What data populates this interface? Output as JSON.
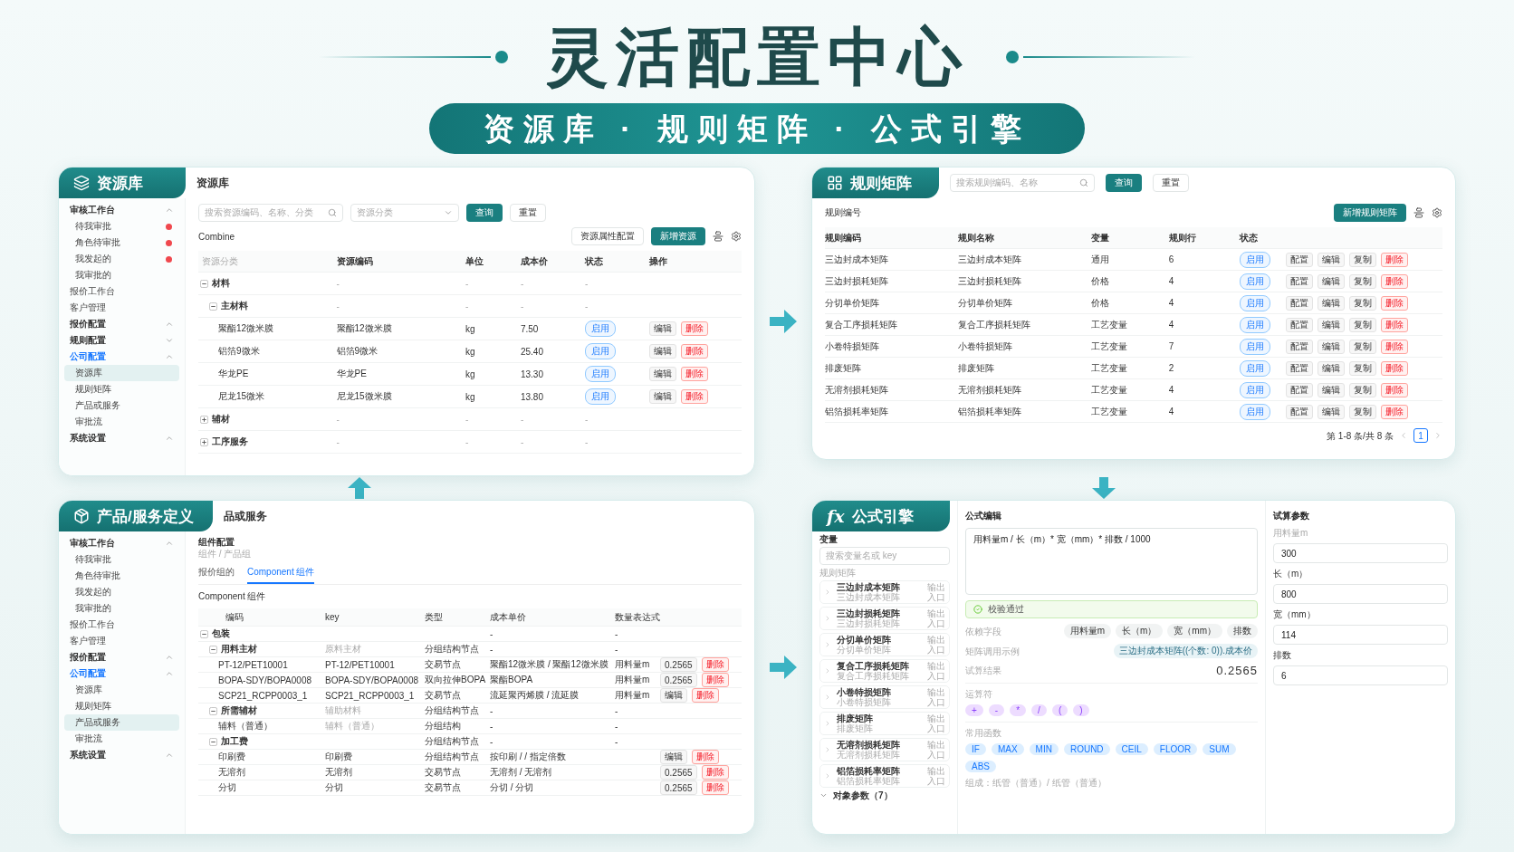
{
  "header": {
    "title": "灵活配置中心",
    "subtitle": "资源库 · 规则矩阵 · 公式引擎"
  },
  "resource_panel": {
    "tab": "资源库",
    "title": "资源库",
    "sidebar": [
      {
        "kind": "group",
        "label": "审核工作台",
        "expanded": true,
        "active": false,
        "children": [
          {
            "label": "待我审批",
            "selected": false,
            "alert": true
          },
          {
            "label": "角色待审批",
            "selected": false,
            "alert": true
          },
          {
            "label": "我发起的",
            "selected": false,
            "alert": true
          },
          {
            "label": "我审批的",
            "selected": false,
            "alert": false
          }
        ]
      },
      {
        "kind": "link",
        "label": "报价工作台"
      },
      {
        "kind": "link",
        "label": "客户管理"
      },
      {
        "kind": "group",
        "label": "报价配置",
        "expanded": true,
        "active": false
      },
      {
        "kind": "group",
        "label": "规则配置",
        "expanded": false,
        "active": false
      },
      {
        "kind": "group",
        "label": "公司配置",
        "expanded": true,
        "active": true,
        "children": [
          {
            "label": "资源库",
            "selected": true,
            "alert": false
          },
          {
            "label": "规则矩阵",
            "selected": false,
            "alert": false
          },
          {
            "label": "产品或服务",
            "selected": false,
            "alert": false
          },
          {
            "label": "审批流",
            "selected": false,
            "alert": false
          }
        ]
      },
      {
        "kind": "group",
        "label": "系统设置",
        "expanded": true,
        "active": false
      }
    ],
    "search": {
      "placeholder": "搜索资源编码、名称、分类"
    },
    "category_select": {
      "placeholder": "资源分类"
    },
    "query_button": "查询",
    "reset_button": "重置",
    "section_label": "Combine",
    "attr_button": "资源属性配置",
    "add_button": "新增资源",
    "columns": [
      "资源分类",
      "资源编码",
      "单位",
      "成本价",
      "状态",
      "操作"
    ],
    "rows": [
      {
        "expanded": true,
        "cells": [
          "材料",
          "-",
          "-",
          "-",
          "-"
        ],
        "children": [
          {
            "expanded": true,
            "cells": [
              "主材料",
              "-",
              "-",
              "-",
              "-"
            ],
            "children": [
              {
                "cells": [
                  "聚酯12微米膜",
                  "聚酯12微米膜",
                  "kg",
                  "7.50"
                ],
                "status": "启用",
                "actions": [
                  {
                    "label": "编辑",
                    "kind": "default"
                  },
                  {
                    "label": "删除",
                    "kind": "danger"
                  }
                ]
              },
              {
                "cells": [
                  "铝箔9微米",
                  "铝箔9微米",
                  "kg",
                  "25.40"
                ],
                "status": "启用",
                "actions": [
                  {
                    "label": "编辑",
                    "kind": "default"
                  },
                  {
                    "label": "删除",
                    "kind": "danger"
                  }
                ]
              },
              {
                "cells": [
                  "华龙PE",
                  "华龙PE",
                  "kg",
                  "13.30"
                ],
                "status": "启用",
                "actions": [
                  {
                    "label": "编辑",
                    "kind": "default"
                  },
                  {
                    "label": "删除",
                    "kind": "danger"
                  }
                ]
              },
              {
                "cells": [
                  "尼龙15微米",
                  "尼龙15微米膜",
                  "kg",
                  "13.80"
                ],
                "status": "启用",
                "actions": [
                  {
                    "label": "编辑",
                    "kind": "default"
                  },
                  {
                    "label": "删除",
                    "kind": "danger"
                  }
                ]
              }
            ]
          }
        ]
      },
      {
        "expanded": false,
        "cells": [
          "辅材",
          "-",
          "-",
          "-",
          "-"
        ]
      },
      {
        "expanded": false,
        "cells": [
          "工序服务",
          "-",
          "-",
          "-",
          "-"
        ]
      }
    ]
  },
  "rules_panel": {
    "tab": "规则矩阵",
    "search": {
      "placeholder": "搜索规则编码、名称"
    },
    "query_button": "查询",
    "reset_button": "重置",
    "section_label": "规则编号",
    "add_button": "新增规则矩阵",
    "columns": [
      "规则编码",
      "规则名称",
      "变量",
      "规则行",
      "状态"
    ],
    "rows": [
      {
        "cells": [
          "三边封成本矩阵",
          "三边封成本矩阵",
          "通用",
          "6"
        ],
        "status": "启用",
        "actions": [
          "配置",
          "编辑",
          "复制",
          "删除"
        ]
      },
      {
        "cells": [
          "三边封损耗矩阵",
          "三边封损耗矩阵",
          "价格",
          "4"
        ],
        "status": "启用",
        "actions": [
          "配置",
          "编辑",
          "复制",
          "删除"
        ]
      },
      {
        "cells": [
          "分切单价矩阵",
          "分切单价矩阵",
          "价格",
          "4"
        ],
        "status": "启用",
        "actions": [
          "配置",
          "编辑",
          "复制",
          "删除"
        ]
      },
      {
        "cells": [
          "复合工序损耗矩阵",
          "复合工序损耗矩阵",
          "工艺变量",
          "4"
        ],
        "status": "启用",
        "actions": [
          "配置",
          "编辑",
          "复制",
          "删除"
        ]
      },
      {
        "cells": [
          "小卷特损矩阵",
          "小卷特损矩阵",
          "工艺变量",
          "7"
        ],
        "status": "启用",
        "actions": [
          "配置",
          "编辑",
          "复制",
          "删除"
        ]
      },
      {
        "cells": [
          "排废矩阵",
          "排废矩阵",
          "工艺变量",
          "2"
        ],
        "status": "启用",
        "actions": [
          "配置",
          "编辑",
          "复制",
          "删除"
        ]
      },
      {
        "cells": [
          "无溶剂损耗矩阵",
          "无溶剂损耗矩阵",
          "工艺变量",
          "4"
        ],
        "status": "启用",
        "actions": [
          "配置",
          "编辑",
          "复制",
          "删除"
        ]
      },
      {
        "cells": [
          "铝箔损耗率矩阵",
          "铝箔损耗率矩阵",
          "工艺变量",
          "4"
        ],
        "status": "启用",
        "actions": [
          "配置",
          "编辑",
          "复制",
          "删除"
        ]
      }
    ],
    "pagination": {
      "summary": "第 1-8 条/共 8 条",
      "pages": [
        {
          "label": "1",
          "selected": true
        }
      ]
    }
  },
  "product_panel": {
    "tab": "产品/服务定义",
    "title": "品或服务",
    "sidebar": [
      {
        "kind": "group",
        "label": "审核工作台",
        "expanded": true,
        "active": false,
        "children": [
          {
            "label": "待我审批",
            "selected": false,
            "alert": false
          },
          {
            "label": "角色待审批",
            "selected": false,
            "alert": false
          },
          {
            "label": "我发起的",
            "selected": false,
            "alert": false
          },
          {
            "label": "我审批的",
            "selected": false,
            "alert": false
          }
        ]
      },
      {
        "kind": "link",
        "label": "报价工作台"
      },
      {
        "kind": "link",
        "label": "客户管理"
      },
      {
        "kind": "group",
        "label": "报价配置",
        "expanded": true,
        "active": false
      },
      {
        "kind": "group",
        "label": "公司配置",
        "expanded": true,
        "active": true,
        "children": [
          {
            "label": "资源库",
            "selected": false,
            "alert": false
          },
          {
            "label": "规则矩阵",
            "selected": false,
            "alert": false
          },
          {
            "label": "产品或服务",
            "selected": true,
            "alert": false
          },
          {
            "label": "审批流",
            "selected": false,
            "alert": false
          }
        ]
      },
      {
        "kind": "group",
        "label": "系统设置",
        "expanded": true,
        "active": false
      }
    ],
    "crumb_title": "组件配置",
    "crumb": "组件 / 产品组",
    "tabs": [
      {
        "label": "报价组的",
        "selected": false
      },
      {
        "label": "Component 组件",
        "selected": true
      }
    ],
    "section_label": "Component 组件",
    "columns": [
      "编码",
      "key",
      "类型",
      "成本单价",
      "数量表达式"
    ],
    "rows": [
      {
        "expanded": true,
        "cells": [
          "包装",
          null,
          null,
          "-",
          "-"
        ],
        "children": [
          {
            "expanded": true,
            "cells": [
              "用料主材",
              "原料主材",
              "分组结构节点",
              "-",
              "-"
            ],
            "children": [
              {
                "cells": [
                  "PT-12/PET10001",
                  "PT-12/PET10001",
                  "交易节点",
                  "聚酯12微米膜 / 聚酯12微米膜",
                  "用料量m"
                ],
                "actions": [
                  {
                    "label": "0.2565",
                    "kind": "default"
                  },
                  {
                    "label": "删除",
                    "kind": "danger"
                  }
                ]
              },
              {
                "cells": [
                  "BOPA-SDY/BOPA0008",
                  "BOPA-SDY/BOPA0008",
                  "双向拉伸BOPA",
                  "聚酯BOPA",
                  "用料量m"
                ],
                "actions": [
                  {
                    "label": "0.2565",
                    "kind": "default"
                  },
                  {
                    "label": "删除",
                    "kind": "danger"
                  }
                ]
              },
              {
                "cells": [
                  "SCP21_RCPP0003_1",
                  "SCP21_RCPP0003_1",
                  "交易节点",
                  "流延聚丙烯膜 / 流延膜",
                  "用料量m"
                ],
                "actions": [
                  {
                    "label": "编辑",
                    "kind": "default"
                  },
                  {
                    "label": "删除",
                    "kind": "danger"
                  }
                ]
              }
            ]
          },
          {
            "expanded": true,
            "cells": [
              "所需辅材",
              "辅助材料",
              "分组结构节点",
              "-",
              "-"
            ],
            "children": [
              {
                "cells": [
                  "辅料（普通）",
                  "辅料（普通）",
                  "分组结构",
                  "-",
                  "-"
                ]
              }
            ]
          },
          {
            "expanded": true,
            "cells": [
              "加工费",
              null,
              "分组结构节点",
              "-",
              "-"
            ],
            "children": [
              {
                "cells": [
                  "印刷费",
                  "印刷费",
                  "分组结构节点",
                  "按印刷 / / 指定倍数",
                  null
                ],
                "actions": [
                  {
                    "label": "编辑",
                    "kind": "default"
                  },
                  {
                    "label": "删除",
                    "kind": "danger"
                  }
                ]
              },
              {
                "cells": [
                  "无溶剂",
                  "无溶剂",
                  "交易节点",
                  "无溶剂 / 无溶剂",
                  null
                ],
                "actions": [
                  {
                    "label": "0.2565",
                    "kind": "default"
                  },
                  {
                    "label": "删除",
                    "kind": "danger"
                  }
                ]
              },
              {
                "cells": [
                  "分切",
                  "分切",
                  "交易节点",
                  "分切 / 分切",
                  null
                ],
                "actions": [
                  {
                    "label": "0.2565",
                    "kind": "default"
                  },
                  {
                    "label": "删除",
                    "kind": "danger"
                  }
                ]
              }
            ]
          }
        ]
      }
    ]
  },
  "formula_panel": {
    "tab": "公式引擎",
    "tab_glyph": "fx",
    "variables_title": "变量",
    "variable_search": {
      "placeholder": "搜索变量名或 key"
    },
    "matrix_label": "规则矩阵",
    "matrices": [
      {
        "name": "三边封成本矩阵",
        "sub": "三边封成本矩阵",
        "meta": [
          "输出",
          "入口"
        ]
      },
      {
        "name": "三边封损耗矩阵",
        "sub": "三边封损耗矩阵",
        "meta": [
          "输出",
          "入口"
        ]
      },
      {
        "name": "分切单价矩阵",
        "sub": "分切单价矩阵",
        "meta": [
          "输出",
          "入口"
        ]
      },
      {
        "name": "复合工序损耗矩阵",
        "sub": "复合工序损耗矩阵",
        "meta": [
          "输出",
          "入口"
        ]
      },
      {
        "name": "小卷特损矩阵",
        "sub": "小卷特损矩阵",
        "meta": [
          "输出",
          "入口"
        ]
      },
      {
        "name": "排废矩阵",
        "sub": "排废矩阵",
        "meta": [
          "输出",
          "入口"
        ]
      },
      {
        "name": "无溶剂损耗矩阵",
        "sub": "无溶剂损耗矩阵",
        "meta": [
          "输出",
          "入口"
        ]
      },
      {
        "name": "铝箔损耗率矩阵",
        "sub": "铝箔损耗率矩阵",
        "meta": [
          "输出",
          "入口"
        ]
      }
    ],
    "object_params": "对象参数（7）",
    "editor_title": "公式编辑",
    "formula": "用料量m / 长（m）* 宽（mm）* 排数 / 1000",
    "validation": {
      "text": "校验通过",
      "passed": true
    },
    "deps_label": "依赖字段",
    "deps": [
      "用料量m",
      "长（m）",
      "宽（mm）",
      "排数"
    ],
    "example_label": "矩阵调用示例",
    "example": "三边封成本矩阵((个数: 0)).成本价",
    "result_label": "试算结果",
    "result": "0.2565",
    "operators_label": "运算符",
    "operators": [
      "+",
      "-",
      "*",
      "/",
      "(",
      ")"
    ],
    "functions_label": "常用函数",
    "functions": [
      "IF",
      "MAX",
      "MIN",
      "ROUND",
      "CEIL",
      "FLOOR",
      "SUM",
      "ABS"
    ],
    "composition": "组成：纸管（普通）/ 纸管（普通）",
    "params_title": "试算参数",
    "params": [
      {
        "label": "用料量m",
        "value": "300"
      },
      {
        "label": "长（m）",
        "value": "800"
      },
      {
        "label": "宽（mm）",
        "value": "114"
      },
      {
        "label": "排数",
        "value": "6"
      }
    ]
  }
}
